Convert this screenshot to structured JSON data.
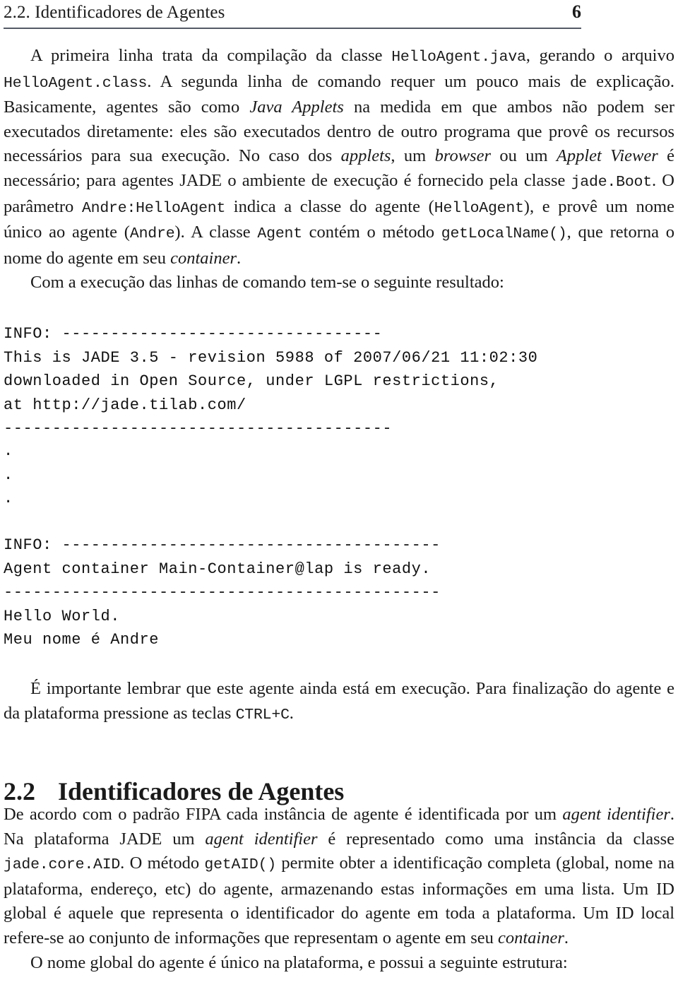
{
  "header": {
    "title": "2.2. Identificadores de Agentes",
    "page_number": "6"
  },
  "paragraphs": {
    "p1": {
      "seg1": "A primeira linha trata da compilação da classe ",
      "code1": "HelloAgent.java",
      "seg2": ", gerando o arquivo ",
      "code2": "HelloAgent.class",
      "seg3": ". A segunda linha de comando requer um pouco mais de explicação. Basicamente, agentes são como ",
      "italic1": "Java Applets",
      "seg4": " na medida em que ambos não podem ser executados diretamente: eles são executados dentro de outro programa que provê os recursos necessários para sua execução. No caso dos ",
      "italic2": "applets",
      "seg5": ", um ",
      "italic3": "browser",
      "seg6": " ou um ",
      "italic4": "Applet Viewer",
      "seg7": " é necessário; para agentes JADE o ambiente de execução é fornecido pela classe ",
      "code3": "jade.Boot",
      "seg8": ". O parâmetro ",
      "code4": "Andre:HelloAgent",
      "seg9": " indica a classe do agente (",
      "code5": "HelloAgent",
      "seg10": "), e provê um nome único ao agente (",
      "code6": "Andre",
      "seg11": "). A classe ",
      "code7": "Agent",
      "seg12": " contém o método ",
      "code8": "getLocalName()",
      "seg13": ", que retorna o nome do agente em seu ",
      "italic5": "container",
      "seg14": "."
    },
    "p2": {
      "text": "Com a execução das linhas de comando tem-se o seguinte resultado:"
    },
    "p3": {
      "seg1": "É importante lembrar que este agente ainda está em execução. Para finalização do agente e da plataforma pressione as teclas ",
      "code1": "CTRL+C",
      "seg2": "."
    },
    "p4": {
      "seg1": "De acordo com o padrão FIPA cada instância de agente é identificada por um ",
      "italic1": "agent identifier",
      "seg2": ". Na plataforma JADE um ",
      "italic2": "agent identifier",
      "seg3": " é representado como uma instância da classe ",
      "code1": "jade.core.AID",
      "seg4": ". O método ",
      "code2": "getAID()",
      "seg5": " permite obter a identificação completa (global, nome na plataforma, endereço, etc) do agente, armazenando estas informações em uma lista. Um ID global é aquele que representa o identificador do agente em toda a plataforma. Um ID local refere-se ao conjunto de informações que representam o agente em seu ",
      "italic3": "container",
      "seg6": "."
    },
    "p5": {
      "text": "O nome global do agente é único na plataforma, e possui a seguinte estrutura:"
    }
  },
  "code_block_1": {
    "lines": [
      "INFO: ---------------------------------",
      "This is JADE 3.5 - revision 5988 of 2007/06/21 11:02:30",
      "downloaded in Open Source, under LGPL restrictions,",
      "at http://jade.tilab.com/",
      "----------------------------------------"
    ]
  },
  "code_dots": {
    "lines": [
      ".",
      ".",
      "."
    ]
  },
  "code_block_2": {
    "lines": [
      "INFO: ---------------------------------------",
      "Agent container Main-Container@lap is ready.",
      "---------------------------------------------",
      "Hello World.",
      "Meu nome é Andre"
    ]
  },
  "section": {
    "number": "2.2",
    "title": "Identificadores de Agentes"
  },
  "colors": {
    "text": "#1a1a1a",
    "rule": "#555b66",
    "code": "#111111"
  }
}
